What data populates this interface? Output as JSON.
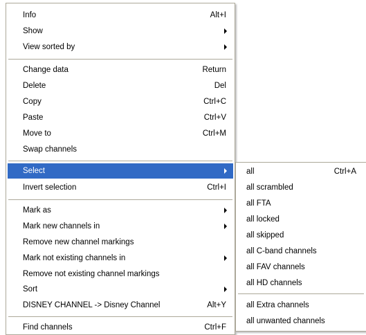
{
  "context_menu": {
    "items": [
      {
        "label": "Info",
        "shortcut": "Alt+I"
      },
      {
        "label": "Show",
        "submenu": true
      },
      {
        "label": "View sorted by",
        "submenu": true
      },
      {
        "label": "Change data",
        "shortcut": "Return"
      },
      {
        "label": "Delete",
        "shortcut": "Del"
      },
      {
        "label": "Copy",
        "shortcut": "Ctrl+C"
      },
      {
        "label": "Paste",
        "shortcut": "Ctrl+V"
      },
      {
        "label": "Move to",
        "shortcut": "Ctrl+M"
      },
      {
        "label": "Swap channels"
      },
      {
        "label": "Select",
        "submenu": true,
        "selected": true
      },
      {
        "label": "Invert selection",
        "shortcut": "Ctrl+I"
      },
      {
        "label": "Mark as",
        "submenu": true
      },
      {
        "label": "Mark new channels in",
        "submenu": true
      },
      {
        "label": "Remove new channel markings"
      },
      {
        "label": "Mark not existing channels in",
        "submenu": true
      },
      {
        "label": "Remove not existing channel markings"
      },
      {
        "label": "Sort",
        "submenu": true
      },
      {
        "label": "DISNEY CHANNEL -> Disney Channel",
        "shortcut": "Alt+Y"
      },
      {
        "label": "Find channels",
        "shortcut": "Ctrl+F"
      }
    ]
  },
  "select_submenu": {
    "items": [
      {
        "label": "all",
        "shortcut": "Ctrl+A"
      },
      {
        "label": "all scrambled"
      },
      {
        "label": "all FTA"
      },
      {
        "label": "all locked"
      },
      {
        "label": "all skipped"
      },
      {
        "label": "all C-band channels"
      },
      {
        "label": "all FAV channels"
      },
      {
        "label": "all HD channels"
      },
      {
        "label": "all Extra channels"
      },
      {
        "label": "all unwanted channels"
      }
    ]
  },
  "colors": {
    "highlight": "#316ac5",
    "highlight_text": "#ffffff",
    "border": "#aca899",
    "background": "#ffffff"
  }
}
